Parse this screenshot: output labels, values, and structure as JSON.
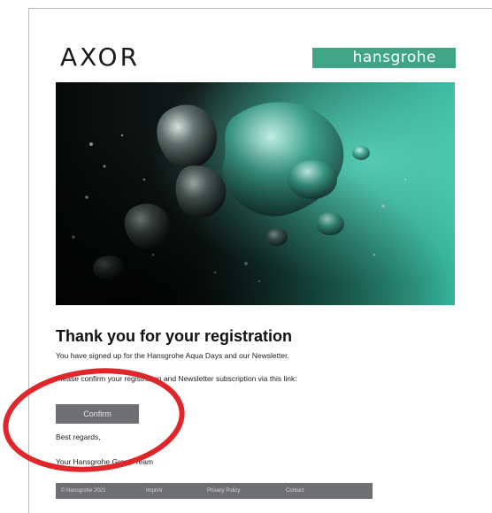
{
  "brand": {
    "axor_logo": "AXOR",
    "hansgrohe_logo": "hansgrohe",
    "hansgrohe_color": "#3fa586"
  },
  "hero": {
    "icon": "water-bubbles-image"
  },
  "content": {
    "headline": "Thank you for your registration",
    "signed_up_text": "You have signed up for the Hansgrohe Aqua Days and our Newsletter.",
    "confirm_prompt": "Please confirm your registration and Newsletter subscription via this link:",
    "confirm_button_label": "Confirm",
    "regards": "Best regards,",
    "team": "Your Hansgrohe Group Team"
  },
  "footer": {
    "copyright": "© Hansgrohe 2021",
    "imprint": "Imprint",
    "privacy": "Privacy Policy",
    "contact": "Contact"
  },
  "colors": {
    "button_bg": "#6d6f72",
    "annotation": "#e0262b"
  }
}
